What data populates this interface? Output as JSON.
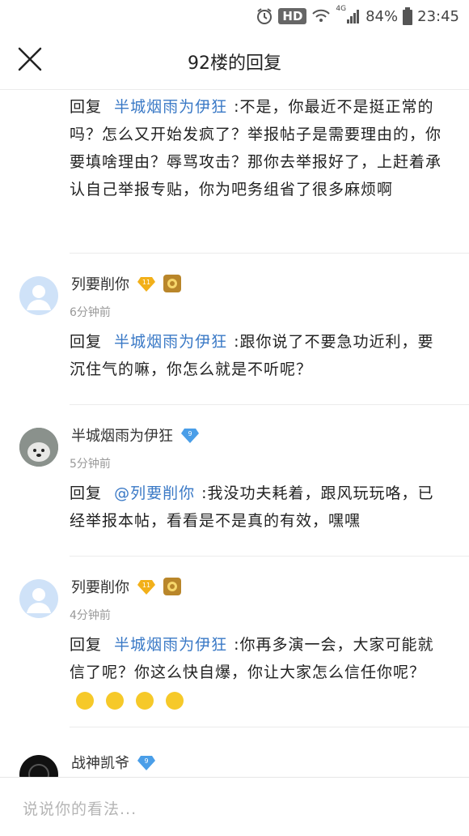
{
  "status": {
    "network": "4G",
    "hd": "HD",
    "battery": "84%",
    "time": "23:45"
  },
  "header": {
    "title": "92楼的回复"
  },
  "replies": [
    {
      "prefix": "回复",
      "target": "半城烟雨为伊狂",
      "text_line1": ":不是，你最近不是挺",
      "text_lines": "正常的吗？怎么又开始发疯了？举报帖子是需要理由的，你要填啥理由？辱骂攻击？那你去举报好了，上赶着承认自己举报专贴，你为吧务组省了很多麻烦啊"
    },
    {
      "user": "列要削你",
      "level": "11",
      "time": "6分钟前",
      "prefix": "回复",
      "target": "半城烟雨为伊狂",
      "text": ":跟你说了不要急功近利，要沉住气的嘛，你怎么就是不听呢？"
    },
    {
      "user": "半城烟雨为伊狂",
      "level": "9",
      "time": "5分钟前",
      "prefix": "回复",
      "target": "@列要削你",
      "text": ":我没功夫耗着，跟风玩玩咯，已经举报本帖，看看是不是真的有效，嘿嘿"
    },
    {
      "user": "列要削你",
      "level": "11",
      "time": "4分钟前",
      "prefix": "回复",
      "target": "半城烟雨为伊狂",
      "text": ":你再多演一会，大家可能就信了呢？你这么快自爆，你让大家怎么信任你呢？"
    },
    {
      "user": "战神凯爷",
      "level": "9"
    }
  ],
  "input": {
    "placeholder": "说说你的看法..."
  },
  "colors": {
    "link": "#3a79c6",
    "divider": "#ececec",
    "gold": "#f2b019",
    "blue_badge": "#4a9ee8"
  }
}
